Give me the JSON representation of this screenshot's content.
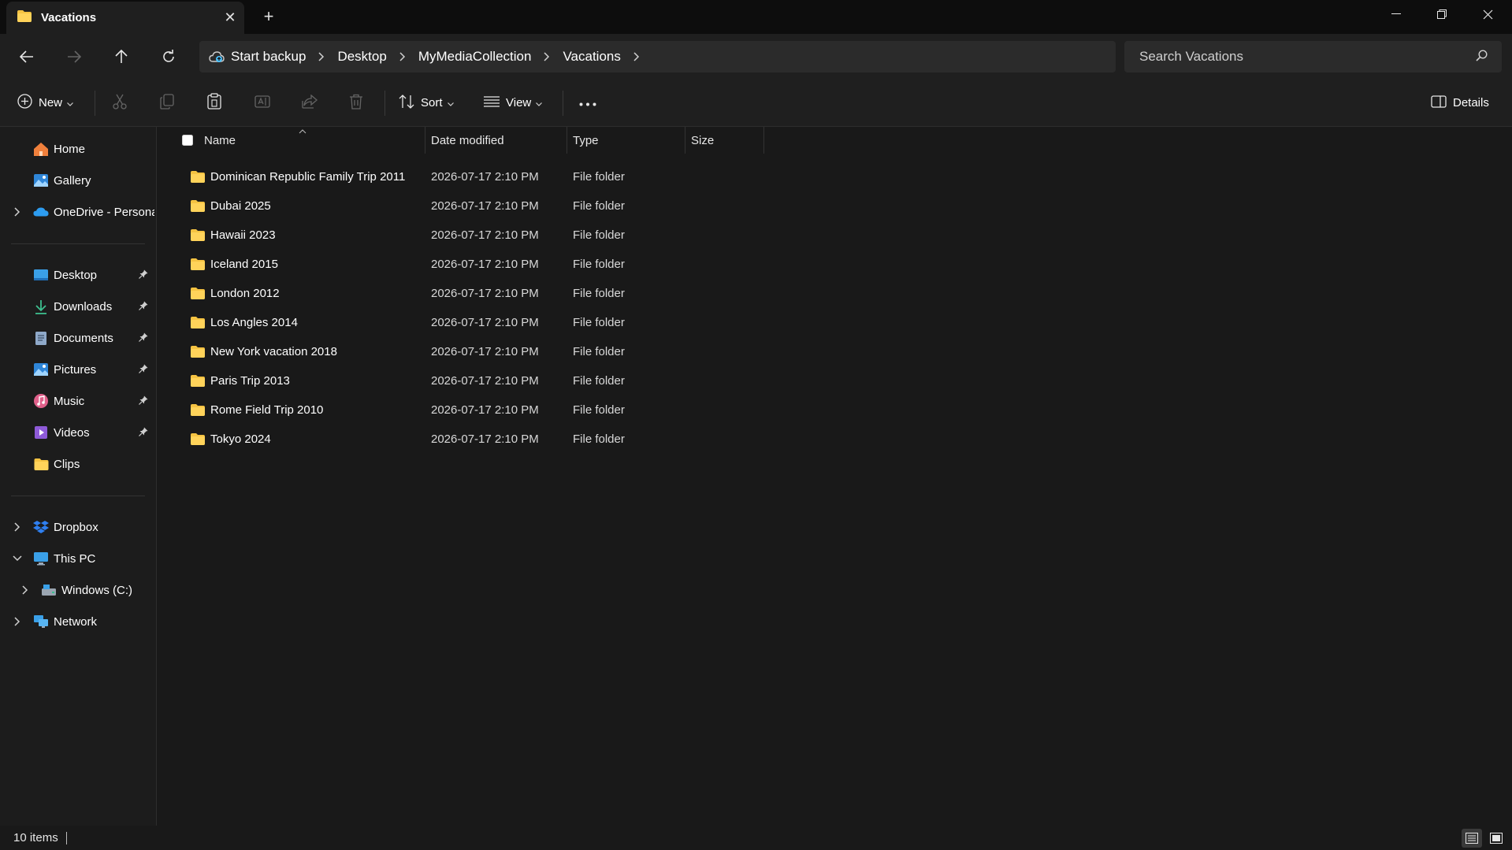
{
  "tab": {
    "title": "Vacations"
  },
  "address": {
    "backup_label": "Start backup",
    "crumbs": [
      "Desktop",
      "MyMediaCollection",
      "Vacations"
    ]
  },
  "search": {
    "placeholder": "Search Vacations"
  },
  "toolbar": {
    "new_label": "New",
    "sort_label": "Sort",
    "view_label": "View",
    "details_label": "Details"
  },
  "sidebar": {
    "quick": [
      {
        "label": "Home",
        "icon": "home-icon"
      },
      {
        "label": "Gallery",
        "icon": "gallery-icon"
      },
      {
        "label": "OneDrive - Personal",
        "icon": "onedrive-icon"
      }
    ],
    "pinned": [
      {
        "label": "Desktop",
        "icon": "desktop-icon"
      },
      {
        "label": "Downloads",
        "icon": "downloads-icon"
      },
      {
        "label": "Documents",
        "icon": "documents-icon"
      },
      {
        "label": "Pictures",
        "icon": "pictures-icon"
      },
      {
        "label": "Music",
        "icon": "music-icon"
      },
      {
        "label": "Videos",
        "icon": "videos-icon"
      },
      {
        "label": "Clips",
        "icon": "folder-icon"
      }
    ],
    "locations": [
      {
        "label": "Dropbox",
        "icon": "dropbox-icon"
      },
      {
        "label": "This PC",
        "icon": "pc-icon"
      },
      {
        "label": "Windows (C:)",
        "icon": "drive-icon"
      },
      {
        "label": "Network",
        "icon": "network-icon"
      }
    ]
  },
  "columns": {
    "name": "Name",
    "date": "Date modified",
    "type": "Type",
    "size": "Size"
  },
  "files": [
    {
      "name": "Dominican Republic Family Trip 2011",
      "date": "2026-07-17 2:10 PM",
      "type": "File folder",
      "size": ""
    },
    {
      "name": "Dubai 2025",
      "date": "2026-07-17 2:10 PM",
      "type": "File folder",
      "size": ""
    },
    {
      "name": "Hawaii 2023",
      "date": "2026-07-17 2:10 PM",
      "type": "File folder",
      "size": ""
    },
    {
      "name": "Iceland 2015",
      "date": "2026-07-17 2:10 PM",
      "type": "File folder",
      "size": ""
    },
    {
      "name": "London 2012",
      "date": "2026-07-17 2:10 PM",
      "type": "File folder",
      "size": ""
    },
    {
      "name": "Los Angles 2014",
      "date": "2026-07-17 2:10 PM",
      "type": "File folder",
      "size": ""
    },
    {
      "name": "New York vacation 2018",
      "date": "2026-07-17 2:10 PM",
      "type": "File folder",
      "size": ""
    },
    {
      "name": "Paris Trip 2013",
      "date": "2026-07-17 2:10 PM",
      "type": "File folder",
      "size": ""
    },
    {
      "name": "Rome Field Trip 2010",
      "date": "2026-07-17 2:10 PM",
      "type": "File folder",
      "size": ""
    },
    {
      "name": "Tokyo 2024",
      "date": "2026-07-17 2:10 PM",
      "type": "File folder",
      "size": ""
    }
  ],
  "status": {
    "count": "10 items"
  },
  "colors": {
    "folder": "#f5c342",
    "background": "#191919",
    "accent": "#4cc2ff"
  }
}
